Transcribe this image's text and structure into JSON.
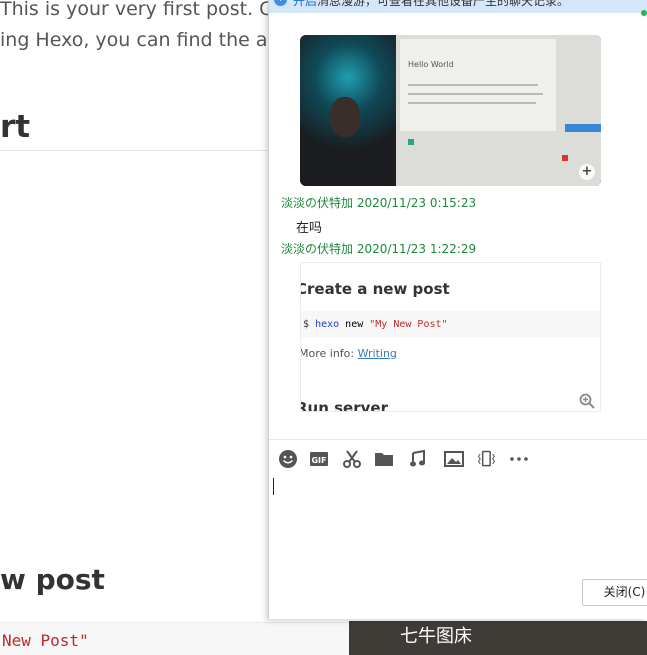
{
  "background": {
    "line1": "This is your very first post. Ch",
    "line2": "ing Hexo, you can find the an",
    "heading1": "rt",
    "heading2": "w post",
    "code": "New Post\"",
    "qiniu_tab": "七牛图床"
  },
  "chat": {
    "notice_link": "开启",
    "notice_text": "消息漫游，可查看在其他设备产生的聊天记录。",
    "image1": {
      "title": "Hello World",
      "zoom_icon": "zoom-in-icon"
    },
    "messages": [
      {
        "sender": "淡淡の伏特加",
        "time": "2020/11/23 0:15:23",
        "text": "在吗"
      },
      {
        "sender": "淡淡の伏特加",
        "time": "2020/11/23 1:22:29"
      }
    ],
    "image2": {
      "heading1": "Create a new post",
      "code_prompt": "$",
      "code_cmd": "hexo",
      "code_sub": " new ",
      "code_str": "\"My New Post\"",
      "more_prefix": "More info: ",
      "more_link": "Writing",
      "heading2": "Run server"
    },
    "toolbar": [
      "emoji-icon",
      "gif-icon",
      "scissors-icon",
      "folder-icon",
      "music-icon",
      "image-icon",
      "shake-icon",
      "more-icon"
    ],
    "gif_label": "GIF",
    "close_button": "关闭(C)"
  }
}
